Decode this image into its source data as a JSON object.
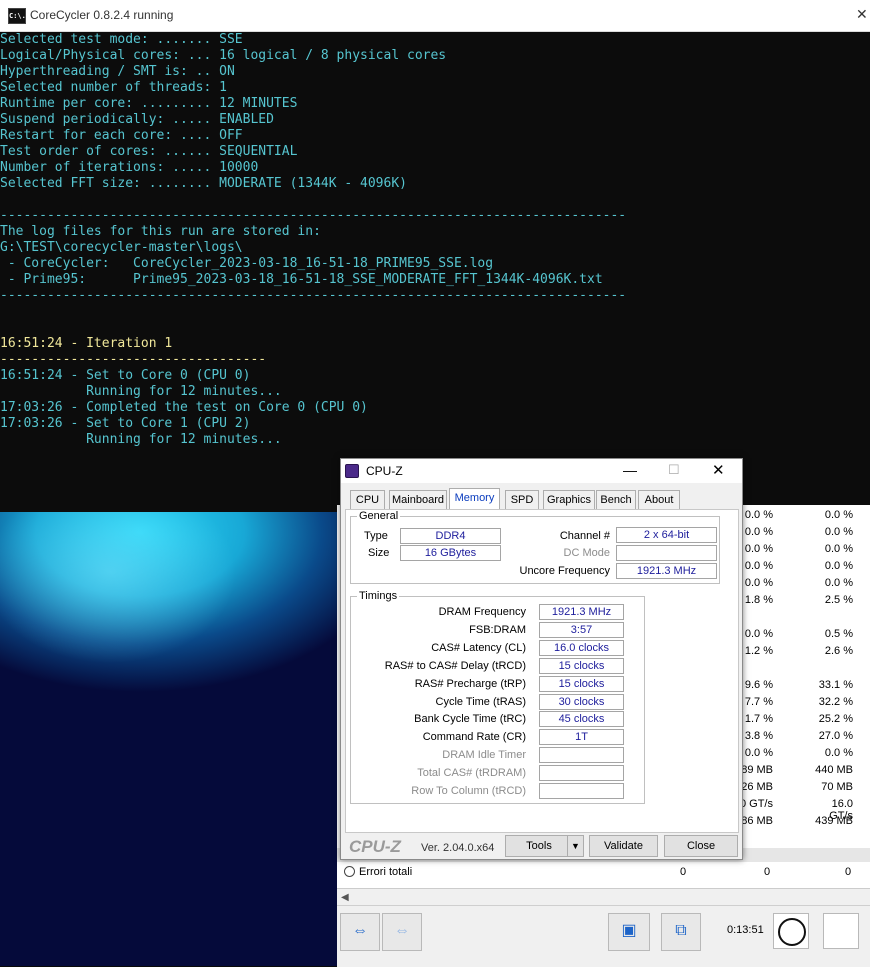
{
  "console": {
    "title": "CoreCycler 0.8.2.4 running",
    "app_icon": "C:\\.",
    "close_glyph": "✕",
    "lines": [
      "Selected test mode: ....... SSE",
      "Logical/Physical cores: ... 16 logical / 8 physical cores",
      "Hyperthreading / SMT is: .. ON",
      "Selected number of threads: 1",
      "Runtime per core: ......... 12 MINUTES",
      "Suspend periodically: ..... ENABLED",
      "Restart for each core: .... OFF",
      "Test order of cores: ...... SEQUENTIAL",
      "Number of iterations: ..... 10000",
      "Selected FFT size: ........ MODERATE (1344K - 4096K)",
      "",
      "--------------------------------------------------------------------------------",
      "The log files for this run are stored in:",
      "G:\\TEST\\corecycler-master\\logs\\",
      " - CoreCycler:   CoreCycler_2023-03-18_16-51-18_PRIME95_SSE.log",
      " - Prime95:      Prime95_2023-03-18_16-51-18_SSE_MODERATE_FFT_1344K-4096K.txt",
      "--------------------------------------------------------------------------------",
      "",
      "",
      "16:51:24 - Iteration 1",
      "----------------------------------",
      "16:51:24 - Set to Core 0 (CPU 0)",
      "           Running for 12 minutes...",
      "17:03:26 - Completed the test on Core 0 (CPU 0)",
      "17:03:26 - Set to Core 1 (CPU 2)",
      "           Running for 12 minutes..."
    ]
  },
  "hwinfo": {
    "rows": [
      {
        "a": "0.0 %",
        "b": "0.0 %"
      },
      {
        "a": "0.0 %",
        "b": "0.0 %"
      },
      {
        "a": "0.0 %",
        "b": "0.0 %"
      },
      {
        "a": "0.0 %",
        "b": "0.0 %"
      },
      {
        "a": "0.0 %",
        "b": "0.0 %"
      },
      {
        "a": "1.8 %",
        "b": "2.5 %"
      },
      {
        "a": "",
        "b": ""
      },
      {
        "a": "0.0 %",
        "b": "0.5 %"
      },
      {
        "a": "1.2 %",
        "b": "2.6 %"
      },
      {
        "a": "",
        "b": ""
      },
      {
        "a": "9.6 %",
        "b": "33.1 %"
      },
      {
        "a": "7.7 %",
        "b": "32.2 %"
      },
      {
        "a": "1.7 %",
        "b": "25.2 %"
      },
      {
        "a": "3.8 %",
        "b": "27.0 %"
      },
      {
        "a": "0.0 %",
        "b": "0.0 %"
      },
      {
        "a": "89 MB",
        "b": "440 MB"
      },
      {
        "a": "26 MB",
        "b": "70 MB"
      },
      {
        "a": "0 GT/s",
        "b": "16.0 GT/s"
      },
      {
        "a": "86 MB",
        "b": "439 MB"
      }
    ],
    "errors_label": "Errori totali",
    "errors_values": [
      "0",
      "0",
      "0"
    ],
    "timer": "0:13:51",
    "scroll_left": "◀"
  },
  "cpuz": {
    "title": "CPU-Z",
    "min_glyph": "—",
    "max_glyph": "☐",
    "close_glyph": "✕",
    "tabs": [
      "CPU",
      "Mainboard",
      "Memory",
      "SPD",
      "Graphics",
      "Bench",
      "About"
    ],
    "general": {
      "legend": "General",
      "type_label": "Type",
      "type_value": "DDR4",
      "size_label": "Size",
      "size_value": "16 GBytes",
      "channel_label": "Channel #",
      "channel_value": "2 x 64-bit",
      "dcmode_label": "DC Mode",
      "dcmode_value": "",
      "uncore_label": "Uncore Frequency",
      "uncore_value": "1921.3 MHz"
    },
    "timings": {
      "legend": "Timings",
      "rows": [
        {
          "label": "DRAM Frequency",
          "value": "1921.3 MHz",
          "dim": false
        },
        {
          "label": "FSB:DRAM",
          "value": "3:57",
          "dim": false
        },
        {
          "label": "CAS# Latency (CL)",
          "value": "16.0 clocks",
          "dim": false
        },
        {
          "label": "RAS# to CAS# Delay (tRCD)",
          "value": "15 clocks",
          "dim": false
        },
        {
          "label": "RAS# Precharge (tRP)",
          "value": "15 clocks",
          "dim": false
        },
        {
          "label": "Cycle Time (tRAS)",
          "value": "30 clocks",
          "dim": false
        },
        {
          "label": "Bank Cycle Time (tRC)",
          "value": "45 clocks",
          "dim": false
        },
        {
          "label": "Command Rate (CR)",
          "value": "1T",
          "dim": false
        },
        {
          "label": "DRAM Idle Timer",
          "value": "",
          "dim": true
        },
        {
          "label": "Total CAS# (tRDRAM)",
          "value": "",
          "dim": true
        },
        {
          "label": "Row To Column (tRCD)",
          "value": "",
          "dim": true
        }
      ]
    },
    "footer": {
      "logo": "CPU-Z",
      "version": "Ver. 2.04.0.x64",
      "tools": "Tools",
      "tools_arrow": "▼",
      "validate": "Validate",
      "close": "Close"
    }
  }
}
